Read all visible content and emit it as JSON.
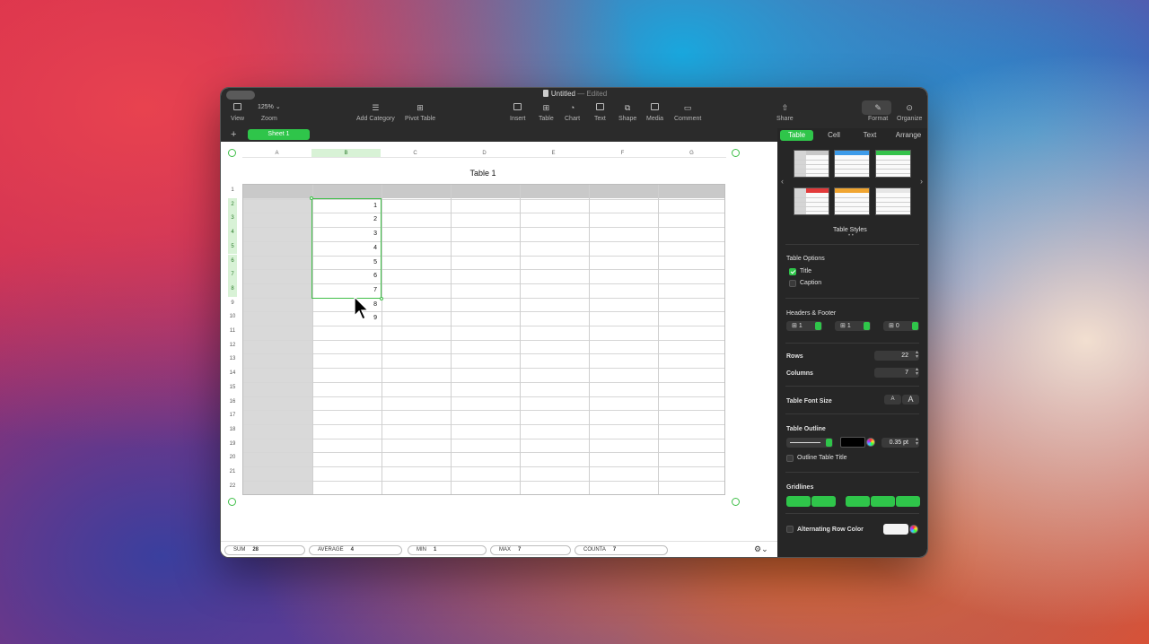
{
  "window": {
    "title": "Untitled",
    "status": "Edited"
  },
  "toolbar": {
    "view": "View",
    "zoom_value": "125%",
    "zoom": "Zoom",
    "add_category": "Add Category",
    "pivot_table": "Pivot Table",
    "insert": "Insert",
    "table": "Table",
    "chart": "Chart",
    "text": "Text",
    "shape": "Shape",
    "media": "Media",
    "comment": "Comment",
    "share": "Share",
    "format": "Format",
    "organize": "Organize"
  },
  "sheets": {
    "add": "+",
    "active": "Sheet 1"
  },
  "table": {
    "title": "Table 1",
    "columns": [
      "A",
      "B",
      "C",
      "D",
      "E",
      "F",
      "G"
    ],
    "rows": [
      "1",
      "2",
      "3",
      "4",
      "5",
      "6",
      "7",
      "8",
      "9",
      "10",
      "11",
      "12",
      "13",
      "14",
      "15",
      "16",
      "17",
      "18",
      "19",
      "20",
      "21",
      "22"
    ],
    "column_b_values": [
      "1",
      "2",
      "3",
      "4",
      "5",
      "6",
      "7",
      "8",
      "9"
    ]
  },
  "status": [
    {
      "label": "SUM",
      "value": "28"
    },
    {
      "label": "AVERAGE",
      "value": "4"
    },
    {
      "label": "MIN",
      "value": "1"
    },
    {
      "label": "MAX",
      "value": "7"
    },
    {
      "label": "COUNTA",
      "value": "7"
    }
  ],
  "sidebar": {
    "tabs": [
      "Table",
      "Cell",
      "Text",
      "Arrange"
    ],
    "table_styles": "Table Styles",
    "style_colors": [
      "#c8c8c8",
      "#3d9be9",
      "#35c24b",
      "#e23a3a",
      "#f0a531",
      "#e6e6e6"
    ],
    "table_options": "Table Options",
    "title_option": "Title",
    "caption_option": "Caption",
    "headers_footer": "Headers & Footer",
    "header_rows": "1",
    "header_cols": "1",
    "footer_rows": "0",
    "rows_label": "Rows",
    "rows_value": "22",
    "columns_label": "Columns",
    "columns_value": "7",
    "font_size_label": "Table Font Size",
    "font_small": "A",
    "font_large": "A",
    "outline_label": "Table Outline",
    "outline_color": "#000000",
    "outline_width": "0.35 pt",
    "outline_title": "Outline Table Title",
    "gridlines": "Gridlines",
    "alternating": "Alternating Row Color"
  }
}
